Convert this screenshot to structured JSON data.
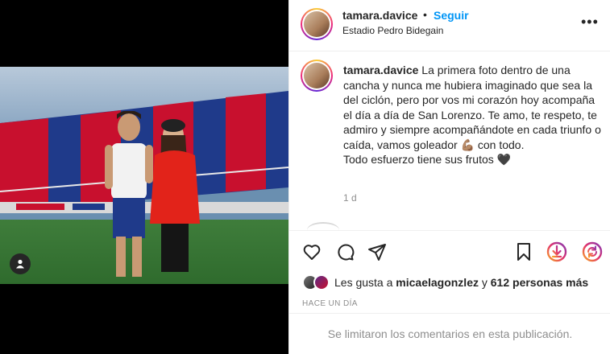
{
  "post": {
    "username": "tamara.davice",
    "dot": "•",
    "follow_label": "Seguir",
    "location": "Estadio Pedro Bidegain",
    "more_label": "•••"
  },
  "caption": {
    "username": "tamara.davice",
    "text_part1": " La primera foto dentro de una cancha y nunca me hubiera imaginado que sea la del ciclón, pero por vos mi corazón hoy acompaña el día a día de San Lorenzo. Te amo, te respeto, te admiro y siempre acompañándote en cada triunfo o caída, vamos goleador ",
    "emoji": "💪🏽",
    "text_part2": " con todo.",
    "line2": "Todo esfuerzo tiene sus frutos",
    "heart": "🖤",
    "time": "1 d"
  },
  "actions": {
    "icons": [
      "heart-icon",
      "comment-icon",
      "share-icon",
      "save-icon",
      "download-icon",
      "repost-icon"
    ],
    "accent_color": "#e1306c"
  },
  "likes": {
    "prefix": "Les gusta a",
    "user": "micaelagonzlez",
    "connector": "y",
    "others": "612 personas más"
  },
  "date_label": "HACE UN DÍA",
  "comments_limited": "Se limitaron los comentarios en esta publicación.",
  "colors": {
    "link": "#0095f6",
    "muted": "#8e8e8e",
    "text": "#262626",
    "club_red": "#c8102e",
    "club_blue": "#1f3a8a"
  }
}
